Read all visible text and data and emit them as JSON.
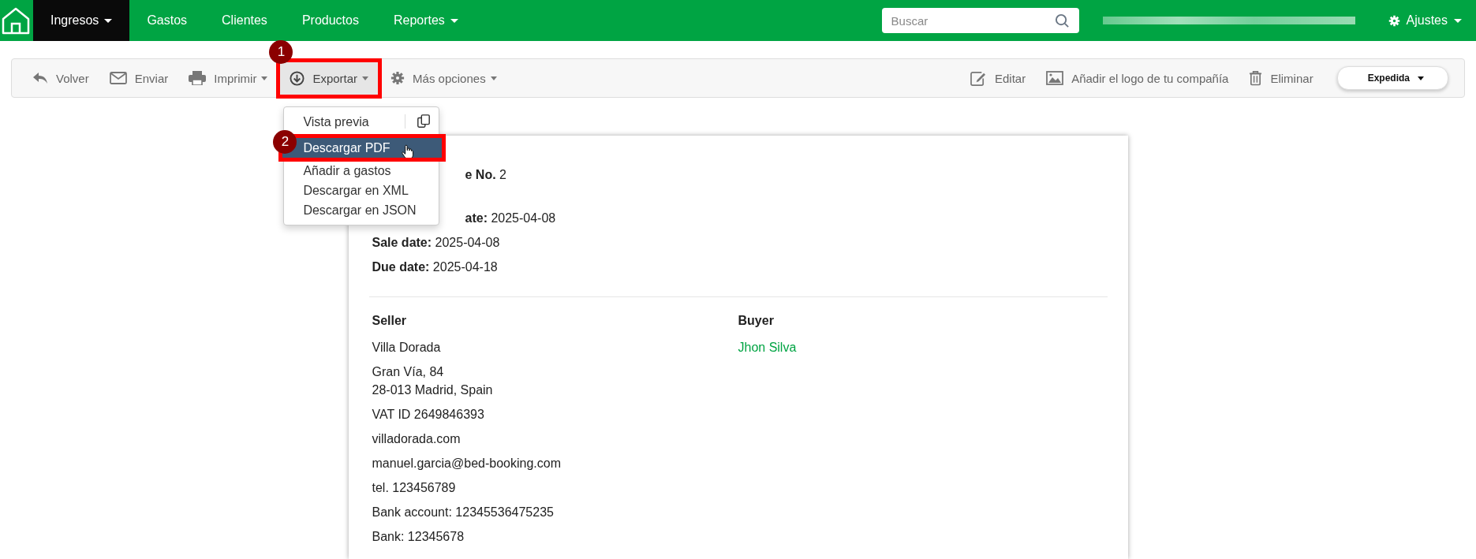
{
  "nav": {
    "items": [
      {
        "label": "Ingresos",
        "dropdown": true,
        "selected": true
      },
      {
        "label": "Gastos",
        "dropdown": false,
        "selected": false
      },
      {
        "label": "Clientes",
        "dropdown": false,
        "selected": false
      },
      {
        "label": "Productos",
        "dropdown": false,
        "selected": false
      },
      {
        "label": "Reportes",
        "dropdown": true,
        "selected": false
      }
    ],
    "search": {
      "placeholder": "Buscar"
    },
    "settings": {
      "label": "Ajustes"
    }
  },
  "toolbar": {
    "left": [
      {
        "label": "Volver",
        "kind": "back",
        "dropdown": false,
        "highlighted": false
      },
      {
        "label": "Enviar",
        "kind": "mail",
        "dropdown": false,
        "highlighted": false
      },
      {
        "label": "Imprimir",
        "kind": "print",
        "dropdown": true,
        "highlighted": false
      },
      {
        "label": "Exportar",
        "kind": "download",
        "dropdown": true,
        "highlighted": true,
        "step": "1"
      },
      {
        "label": "Más opciones",
        "kind": "gear",
        "dropdown": true,
        "highlighted": false
      }
    ],
    "right": [
      {
        "label": "Editar",
        "kind": "edit",
        "dropdown": false,
        "highlighted": false
      },
      {
        "label": "Añadir el logo de tu compañía",
        "kind": "image",
        "dropdown": false,
        "highlighted": false
      },
      {
        "label": "Eliminar",
        "kind": "trash",
        "dropdown": false,
        "highlighted": false
      }
    ],
    "status": {
      "label": "Expedida"
    }
  },
  "export_menu": {
    "items": [
      {
        "label": "Vista previa",
        "selected": false,
        "highlighted": false,
        "side_icon": true
      },
      {
        "label": "Descargar PDF",
        "selected": true,
        "highlighted": true,
        "step": "2",
        "side_icon": false
      },
      {
        "label": "Añadir a gastos",
        "selected": false,
        "highlighted": false,
        "side_icon": false
      },
      {
        "label": "Descargar en XML",
        "selected": false,
        "highlighted": false,
        "side_icon": false
      },
      {
        "label": "Descargar en JSON",
        "selected": false,
        "highlighted": false,
        "side_icon": false
      }
    ]
  },
  "invoice": {
    "number_row": {
      "label": "e No.",
      "value": "2",
      "clipped": true
    },
    "date_rows": [
      {
        "label": "ate:",
        "value": "2025-04-08",
        "clipped": true
      },
      {
        "label": "Sale date:",
        "value": "2025-04-08",
        "clipped": false
      },
      {
        "label": "Due date:",
        "value": "2025-04-18"
      }
    ],
    "seller": {
      "heading": "Seller",
      "groups": [
        [
          "Villa Dorada"
        ],
        [
          "Gran Vía, 84",
          "28-013 Madrid, Spain"
        ],
        [
          "VAT ID 2649846393"
        ],
        [
          "villadorada.com"
        ],
        [
          "manuel.garcia@bed-booking.com"
        ],
        [
          "tel. 123456789"
        ],
        [
          "Bank account: 12345536475235"
        ],
        [
          "Bank: 12345678"
        ]
      ]
    },
    "buyer": {
      "heading": "Buyer",
      "name": "Jhon Silva"
    }
  }
}
